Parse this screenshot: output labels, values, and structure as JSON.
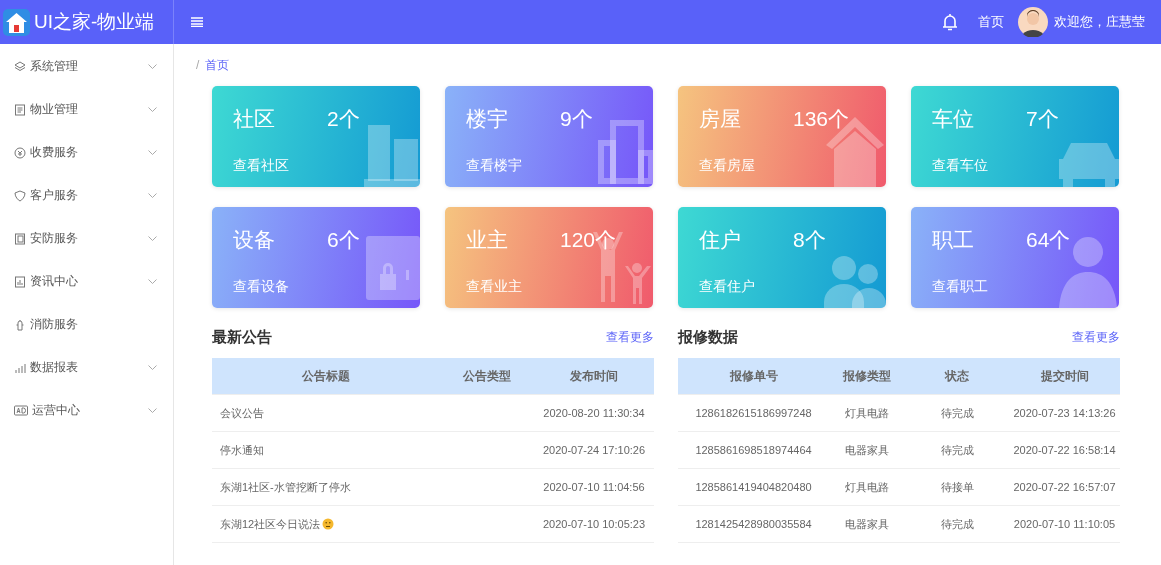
{
  "brand": {
    "title": "UI之家-物业端"
  },
  "header": {
    "home_link": "首页",
    "greeting": "欢迎您，庄慧莹"
  },
  "sidebar": {
    "items": [
      {
        "label": "系统管理",
        "kind": "layers",
        "expandable": true
      },
      {
        "label": "物业管理",
        "kind": "doc",
        "expandable": true
      },
      {
        "label": "收费服务",
        "kind": "coin",
        "expandable": true
      },
      {
        "label": "客户服务",
        "kind": "shield",
        "expandable": true
      },
      {
        "label": "安防服务",
        "kind": "door",
        "expandable": true
      },
      {
        "label": "资讯中心",
        "kind": "news",
        "expandable": true
      },
      {
        "label": "消防服务",
        "kind": "hydrant",
        "expandable": false
      },
      {
        "label": "数据报表",
        "kind": "chart",
        "expandable": true
      },
      {
        "label": "运营中心",
        "kind": "ad",
        "expandable": true
      }
    ]
  },
  "breadcrumb": {
    "separator": "/",
    "current": "首页"
  },
  "stat_cards": [
    {
      "title": "社区",
      "count": "2个",
      "link": "查看社区",
      "kind": "buildings"
    },
    {
      "title": "楼宇",
      "count": "9个",
      "link": "查看楼宇",
      "kind": "tower"
    },
    {
      "title": "房屋",
      "count": "136个",
      "link": "查看房屋",
      "kind": "house"
    },
    {
      "title": "车位",
      "count": "7个",
      "link": "查看车位",
      "kind": "car"
    },
    {
      "title": "设备",
      "count": "6个",
      "link": "查看设备",
      "kind": "safe"
    },
    {
      "title": "业主",
      "count": "120个",
      "link": "查看业主",
      "kind": "family"
    },
    {
      "title": "住户",
      "count": "8个",
      "link": "查看住户",
      "kind": "people"
    },
    {
      "title": "职工",
      "count": "64个",
      "link": "查看职工",
      "kind": "worker"
    }
  ],
  "notices": {
    "title": "最新公告",
    "more": "查看更多",
    "columns": [
      "公告标题",
      "公告类型",
      "发布时间"
    ],
    "rows": [
      {
        "title": "会议公告",
        "time": "2020-08-20 11:30:34",
        "emoji": false
      },
      {
        "title": "停水通知",
        "time": "2020-07-24 17:10:26",
        "emoji": false
      },
      {
        "title": "东湖1社区-水管挖断了停水",
        "time": "2020-07-10 11:04:56",
        "emoji": false
      },
      {
        "title": "东湖12社区今日说法",
        "time": "2020-07-10 10:05:23",
        "emoji": true
      }
    ]
  },
  "repairs": {
    "title": "报修数据",
    "more": "查看更多",
    "columns": [
      "报修单号",
      "报修类型",
      "状态",
      "提交时间"
    ],
    "rows": [
      [
        "1286182615186997248",
        "灯具电路",
        "待完成",
        "2020-07-23 14:13:26"
      ],
      [
        "1285861698518974464",
        "电器家具",
        "待完成",
        "2020-07-22 16:58:14"
      ],
      [
        "1285861419404820480",
        "灯具电路",
        "待接单",
        "2020-07-22 16:57:07"
      ],
      [
        "1281425428980035584",
        "电器家具",
        "待完成",
        "2020-07-10 11:10:05"
      ]
    ]
  }
}
